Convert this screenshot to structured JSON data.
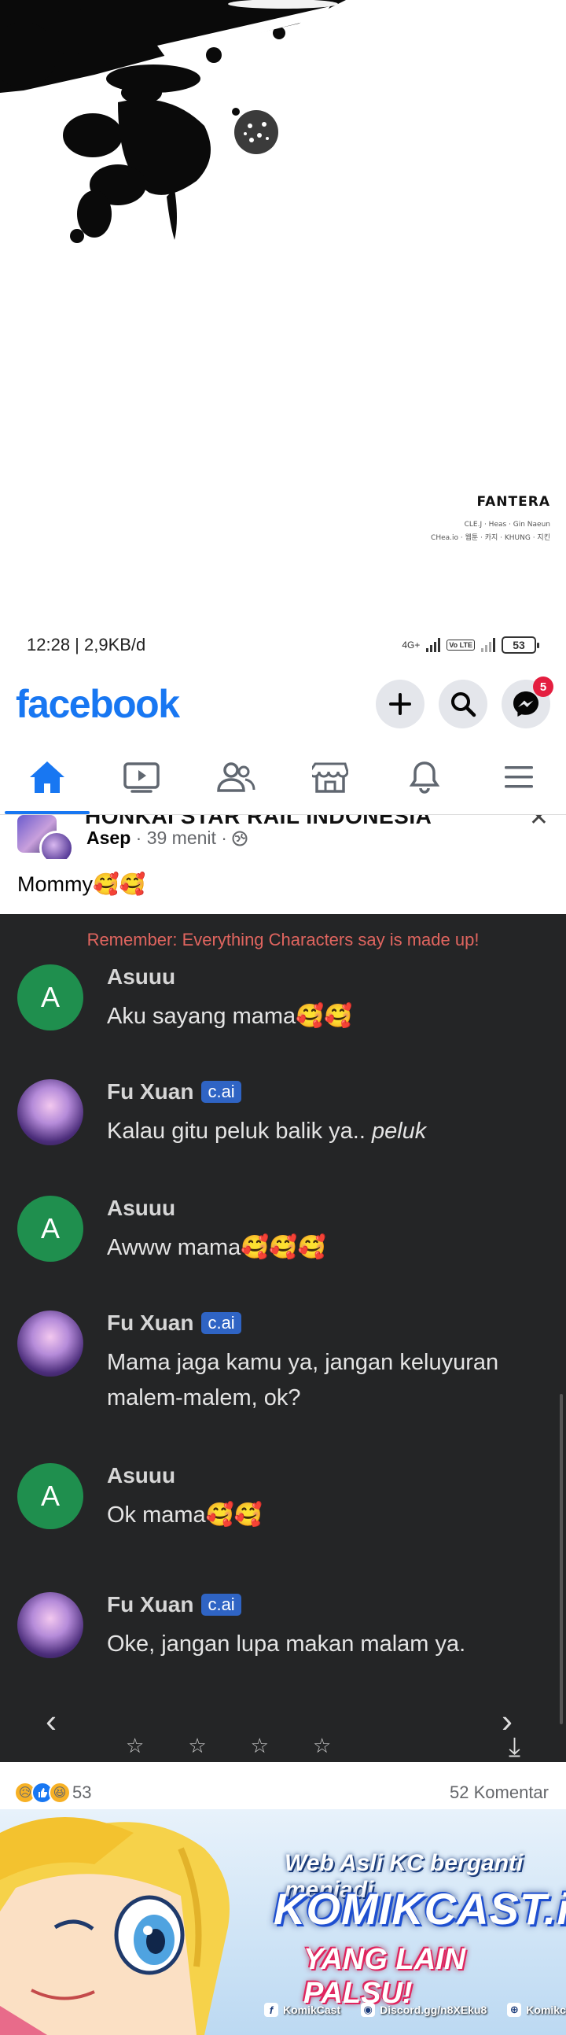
{
  "credits": {
    "title": "FANTERA",
    "line1": "CLE.J · Heas · Gin Naeun",
    "line2": "CHea.io · 웹툰 · 카지 · KHUNG · 지킨"
  },
  "status_bar": {
    "time_speed": "12:28 | 2,9KB/d",
    "network_label": "4G+",
    "volte_label": "Vo LTE",
    "battery": "53"
  },
  "header": {
    "logo": "facebook",
    "messenger_badge": "5"
  },
  "nav": {
    "active_tab": "home",
    "tabs": [
      "home",
      "video",
      "friends",
      "marketplace",
      "notifications",
      "menu"
    ]
  },
  "post": {
    "group_name": "HONKAI STAR RAIL INDONESIA",
    "author": "Asep",
    "time": "· 39 menit ·",
    "text": "Mommy🥰🥰"
  },
  "chat": {
    "notice": "Remember: Everything Characters say is made up!",
    "badge_label": "c.ai",
    "messages": [
      {
        "name": "Asuuu",
        "initial": "A",
        "text": "Aku sayang mama🥰🥰"
      },
      {
        "name": "Fu Xuan",
        "initial": "",
        "text_plain": "Kalau gitu peluk balik ya.. ",
        "text_italic": "peluk"
      },
      {
        "name": "Asuuu",
        "initial": "A",
        "text": "Awww mama🥰🥰🥰"
      },
      {
        "name": "Fu Xuan",
        "initial": "",
        "text": "Mama jaga kamu ya, jangan keluyuran malem-malem, ok?"
      },
      {
        "name": "Asuuu",
        "initial": "A",
        "text": "Ok mama🥰🥰"
      },
      {
        "name": "Fu Xuan",
        "initial": "",
        "text": "Oke, jangan lupa makan malam ya."
      }
    ],
    "prev_arrow": "‹",
    "next_arrow": "›",
    "rating_stars": "☆",
    "scroll_down": "⤓"
  },
  "reactions": {
    "count": "53",
    "comments": "52 Komentar"
  },
  "banner": {
    "line1": "Web Asli KC berganti menjadi",
    "line2": "KOMIKCAST.io",
    "line3": "YANG LAIN PALSU!",
    "link1": "KomikCast",
    "link2": "Discord.gg/n8XEku8",
    "link3": "Komikcast.io"
  }
}
